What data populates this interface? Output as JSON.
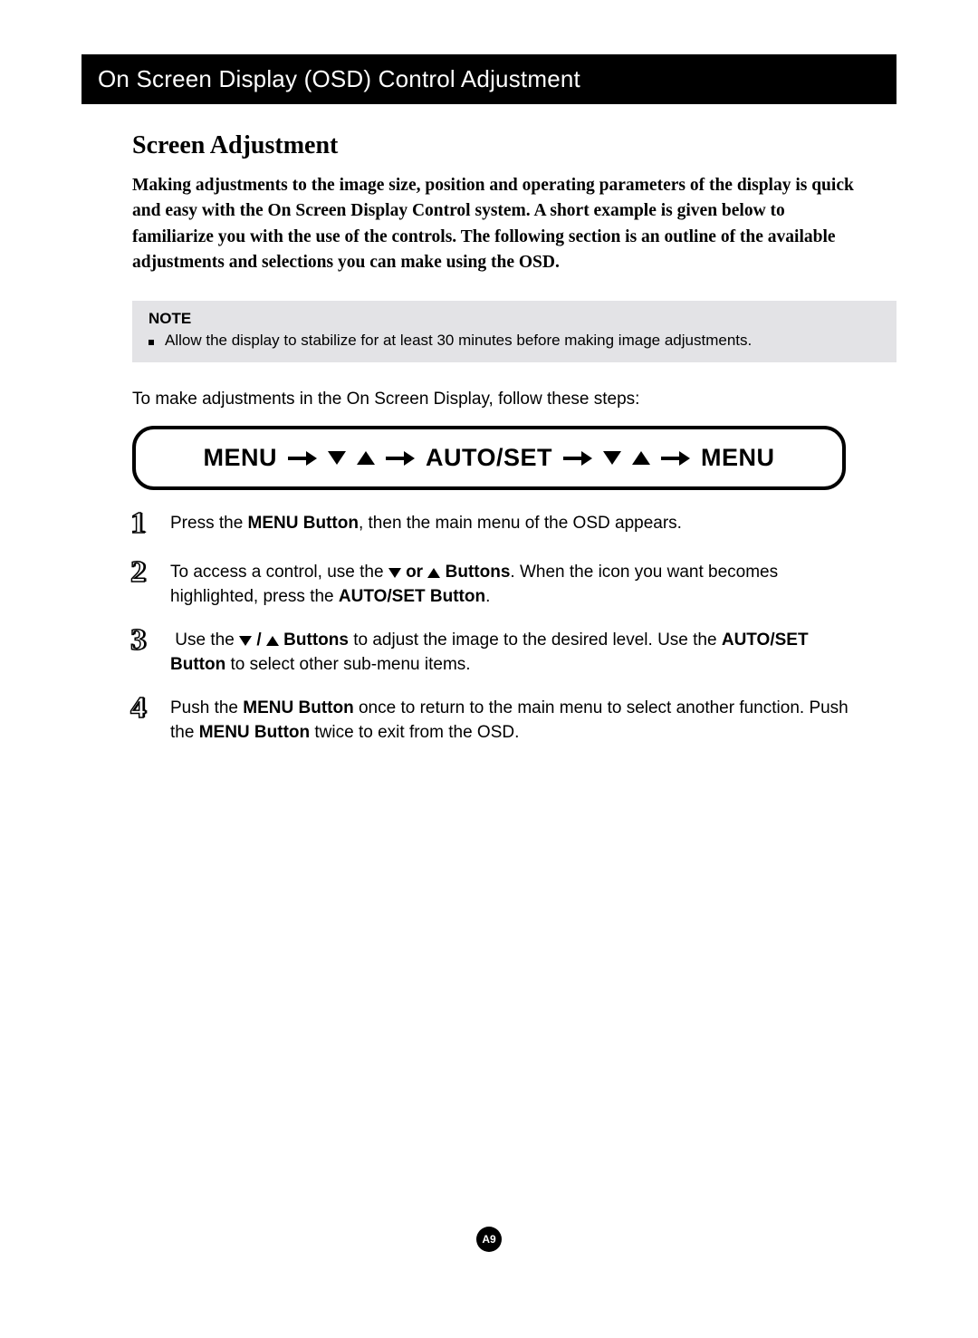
{
  "header": {
    "title": "On Screen Display (OSD) Control Adjustment"
  },
  "section": {
    "title": "Screen Adjustment"
  },
  "intro": {
    "text": "Making adjustments to the image size, position and operating parameters of the display is quick and easy with the On Screen Display Control system. A short example is given below to familiarize you with the use of the controls. The following section is an outline of the available adjustments and selections you can make using the OSD."
  },
  "note": {
    "label": "NOTE",
    "items": [
      "Allow the display to stabilize for at least 30 minutes before making image adjustments."
    ]
  },
  "lead_in": "To make adjustments in the On Screen Display, follow these steps:",
  "flow": {
    "menu1": "MENU",
    "autoset": "AUTO/SET",
    "menu2": "MENU"
  },
  "steps": {
    "s1": {
      "num": "1",
      "pre": "Press the ",
      "b1": "MENU Button",
      "post": ", then the main menu of the OSD appears."
    },
    "s2": {
      "num": "2",
      "pre": "To access a control, use the ",
      "mid": " or ",
      "b1": " Buttons",
      "aft1": ". When the icon you want becomes highlighted, press the ",
      "b2": "AUTO/SET Button",
      "aft2": "."
    },
    "s3": {
      "num": "3",
      "pre": "Use the ",
      "slash": " / ",
      "b1": " Buttons",
      "aft1": " to adjust the image to the desired level. Use the ",
      "b2": "AUTO/SET Button",
      "aft2": " to select other sub-menu items."
    },
    "s4": {
      "num": "4",
      "pre": "Push the ",
      "b1": "MENU Button",
      "mid": " once to return to the main menu to select another function. Push the ",
      "b2": "MENU Button",
      "aft": " twice to exit from the OSD."
    }
  },
  "footer": {
    "page": "A9"
  }
}
